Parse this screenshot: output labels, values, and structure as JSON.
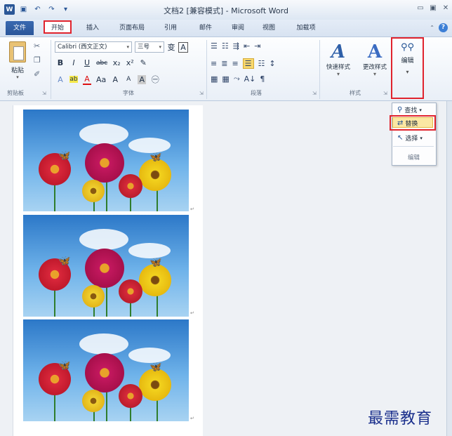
{
  "title": {
    "text": "文档2 [兼容模式] - Microsoft Word",
    "window_buttons": [
      "▭",
      "▣",
      "✕"
    ]
  },
  "tabs": [
    {
      "label": "文件"
    },
    {
      "label": "开始"
    },
    {
      "label": "插入"
    },
    {
      "label": "页面布局"
    },
    {
      "label": "引用"
    },
    {
      "label": "邮件"
    },
    {
      "label": "审阅"
    },
    {
      "label": "视图"
    },
    {
      "label": "加载项"
    }
  ],
  "ribbon": {
    "clipboard": {
      "paste_label": "粘贴",
      "group_label": "剪贴板"
    },
    "font": {
      "font_name": "Calibri (西文正文)",
      "font_size": "三号",
      "group_label": "字体",
      "row2": [
        "B",
        "I",
        "U",
        "abc",
        "x₂",
        "x²",
        "✎"
      ],
      "row3": [
        "A",
        "ab",
        "A",
        "Aa",
        "A",
        "A",
        "A",
        "㊀"
      ],
      "row1_extra": [
        "变",
        "A"
      ]
    },
    "paragraph": {
      "group_label": "段落",
      "row1": [
        "☰",
        "☷",
        "⇶",
        "⇤",
        "⇥"
      ],
      "row2": [
        "≡",
        "≣",
        "≡",
        "☰",
        "☷",
        "↕"
      ],
      "row3": [
        "▦",
        "▦",
        "⤳",
        "A↓",
        "¶"
      ]
    },
    "styles": {
      "group_label": "样式",
      "quick_styles_label": "快速样式",
      "change_styles_label": "更改样式"
    },
    "editing": {
      "button_label": "编辑"
    }
  },
  "edit_menu": {
    "find_label": "查找",
    "replace_label": "替换",
    "select_label": "选择",
    "group_label": "编辑"
  },
  "watermark": "最需教育"
}
